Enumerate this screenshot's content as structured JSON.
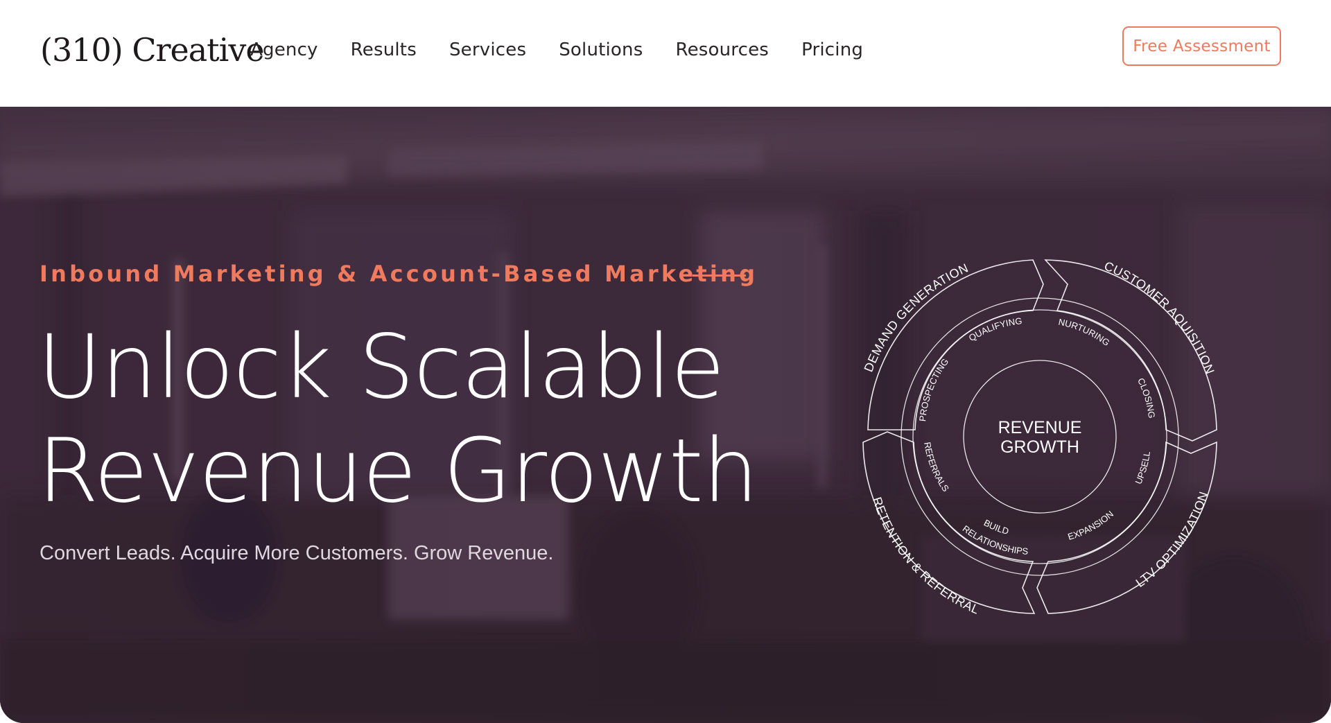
{
  "brand": {
    "logo_text": "(310) Creative"
  },
  "nav": {
    "links": [
      {
        "label": "Agency"
      },
      {
        "label": "Results"
      },
      {
        "label": "Services"
      },
      {
        "label": "Solutions"
      },
      {
        "label": "Resources"
      },
      {
        "label": "Pricing"
      }
    ],
    "cta_label": "Free Assessment"
  },
  "hero": {
    "eyebrow": "Inbound Marketing & Account-Based Marketing",
    "headline_line1": "Unlock Scalable",
    "headline_line2": "Revenue Growth",
    "subhead": "Convert Leads. Acquire More Customers. Grow Revenue."
  },
  "diagram": {
    "center_line1": "REVENUE",
    "center_line2": "GROWTH",
    "outer_segments": [
      "DEMAND GENERATION",
      "CUSTOMER AQUISITION",
      "LTV OPTIMIZATION",
      "RETENTION & REFERRAL"
    ],
    "inner_stages": [
      "QUALIFYING",
      "NURTURING",
      "CLOSING",
      "UPSELL",
      "EXPANSION",
      "BUILD",
      "RELATIONSHIPS",
      "REFERRALS",
      "PROSPECTING"
    ]
  },
  "colors": {
    "accent": "#ef7a5d",
    "hero_overlay": "#3d2a3b",
    "nav_text": "#2a2628",
    "white": "#ffffff"
  }
}
